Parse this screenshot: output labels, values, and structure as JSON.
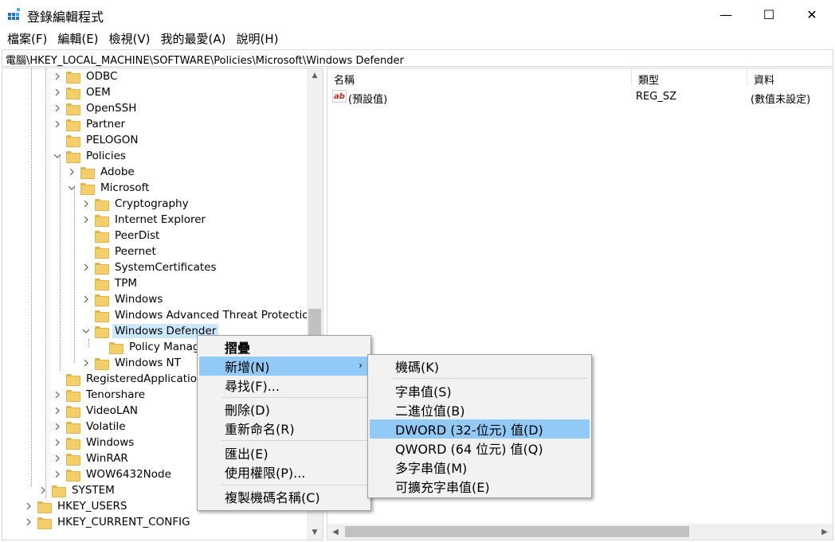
{
  "window": {
    "title": "登錄編輯程式",
    "minimize_glyph": "—",
    "maximize_glyph": "☐",
    "close_glyph": "✕"
  },
  "menubar": [
    "檔案(F)",
    "編輯(E)",
    "檢視(V)",
    "我的最愛(A)",
    "說明(H)"
  ],
  "address": "電腦\\HKEY_LOCAL_MACHINE\\SOFTWARE\\Policies\\Microsoft\\Windows Defender",
  "tree": [
    {
      "label": "ODBC",
      "expander": "collapsed"
    },
    {
      "label": "OEM",
      "expander": "collapsed"
    },
    {
      "label": "OpenSSH",
      "expander": "collapsed"
    },
    {
      "label": "Partner",
      "expander": "collapsed"
    },
    {
      "label": "PELOGON",
      "expander": "none"
    },
    {
      "label": "Policies",
      "expander": "expanded"
    },
    {
      "label": "Adobe",
      "expander": "collapsed"
    },
    {
      "label": "Microsoft",
      "expander": "expanded"
    },
    {
      "label": "Cryptography",
      "expander": "collapsed"
    },
    {
      "label": "Internet Explorer",
      "expander": "collapsed"
    },
    {
      "label": "PeerDist",
      "expander": "none"
    },
    {
      "label": "Peernet",
      "expander": "none"
    },
    {
      "label": "SystemCertificates",
      "expander": "collapsed"
    },
    {
      "label": "TPM",
      "expander": "none"
    },
    {
      "label": "Windows",
      "expander": "collapsed"
    },
    {
      "label": "Windows Advanced Threat Protection",
      "expander": "none"
    },
    {
      "label": "Windows Defender",
      "expander": "expanded",
      "selected": true
    },
    {
      "label": "Policy Manager",
      "expander": "none"
    },
    {
      "label": "Windows NT",
      "expander": "collapsed"
    },
    {
      "label": "RegisteredApplications",
      "expander": "none"
    },
    {
      "label": "Tenorshare",
      "expander": "collapsed"
    },
    {
      "label": "VideoLAN",
      "expander": "collapsed"
    },
    {
      "label": "Volatile",
      "expander": "collapsed"
    },
    {
      "label": "Windows",
      "expander": "collapsed"
    },
    {
      "label": "WinRAR",
      "expander": "collapsed"
    },
    {
      "label": "WOW6432Node",
      "expander": "collapsed"
    },
    {
      "label": "SYSTEM",
      "expander": "collapsed"
    },
    {
      "label": "HKEY_USERS",
      "expander": "collapsed"
    },
    {
      "label": "HKEY_CURRENT_CONFIG",
      "expander": "collapsed"
    }
  ],
  "values_list": {
    "columns": [
      "名稱",
      "類型",
      "資料"
    ],
    "rows": [
      {
        "icon": "string-value-icon",
        "icon_text": "ab",
        "name": "(預設值)",
        "type": "REG_SZ",
        "data": "(數值未設定)"
      }
    ]
  },
  "context_menu": {
    "items": [
      {
        "label": "摺疊",
        "bold": true
      },
      {
        "label": "新增(N)",
        "highlighted": true,
        "submenu": true
      },
      {
        "label": "尋找(F)..."
      },
      {
        "label": "刪除(D)"
      },
      {
        "label": "重新命名(R)"
      },
      {
        "label": "匯出(E)"
      },
      {
        "label": "使用權限(P)..."
      },
      {
        "label": "複製機碼名稱(C)"
      }
    ],
    "submenu_arrow": "›"
  },
  "new_submenu": {
    "items": [
      {
        "label": "機碼(K)"
      },
      {
        "label": "字串值(S)"
      },
      {
        "label": "二進位值(B)"
      },
      {
        "label": "DWORD (32-位元) 值(D)",
        "highlighted": true
      },
      {
        "label": "QWORD (64 位元) 值(Q)"
      },
      {
        "label": "多字串值(M)"
      },
      {
        "label": "可擴充字串值(E)"
      }
    ]
  },
  "colors": {
    "selection": "#cce8ff",
    "menu_highlight": "#91c9f7",
    "folder": "#f3ce6a"
  }
}
